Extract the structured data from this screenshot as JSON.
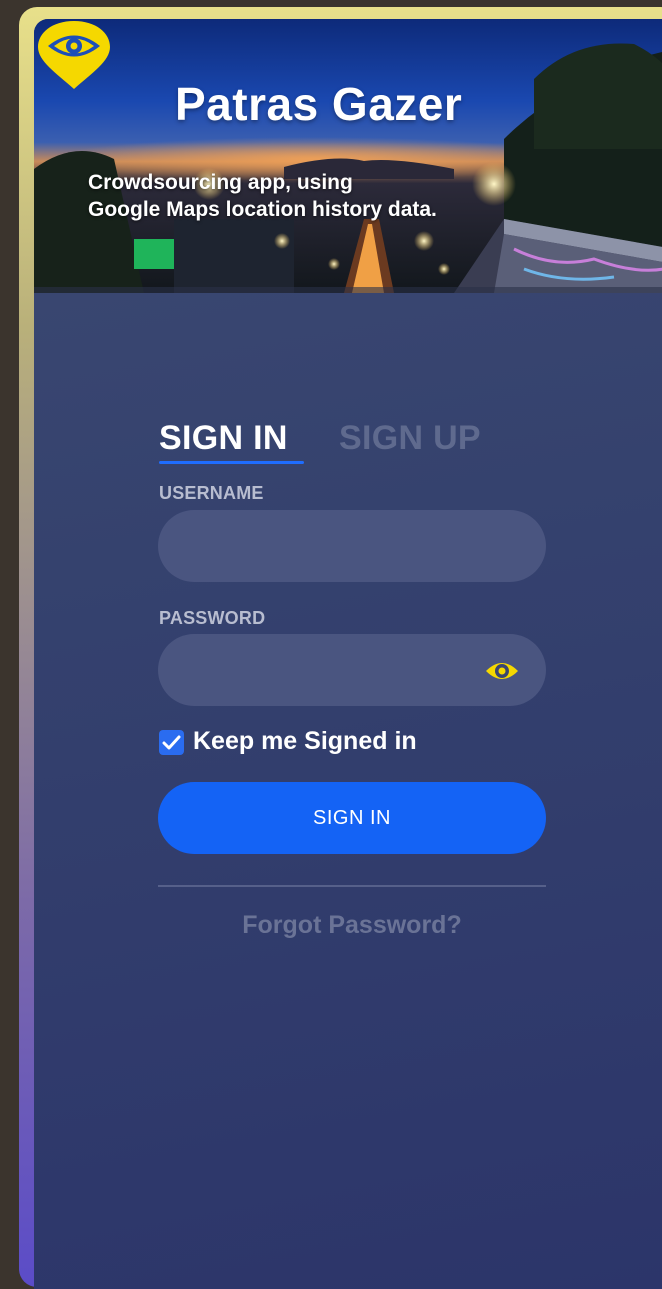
{
  "hero": {
    "brand": "Patras Gazer",
    "tagline_line1": "Crowdsourcing app, using",
    "tagline_line2": "Google Maps location history data."
  },
  "tabs": {
    "signin": "SIGN IN",
    "signup": "SIGN UP",
    "active": "signin"
  },
  "form": {
    "username_label": "USERNAME",
    "username_value": "",
    "password_label": "PASSWORD",
    "password_value": "",
    "keep_signed_in_label": "Keep me Signed in",
    "keep_signed_in_checked": true,
    "submit_label": "SIGN IN",
    "forgot_label": "Forgot Password?"
  },
  "icons": {
    "logo": "eye-map-pin-icon",
    "password_toggle": "eye-icon",
    "checkbox": "checkmark-icon"
  },
  "colors": {
    "accent_blue": "#1463f5",
    "logo_yellow": "#f5d800",
    "panel_bg": "#35426e",
    "input_bg": "#4a5580",
    "inactive_text": "#5f6a8e"
  }
}
